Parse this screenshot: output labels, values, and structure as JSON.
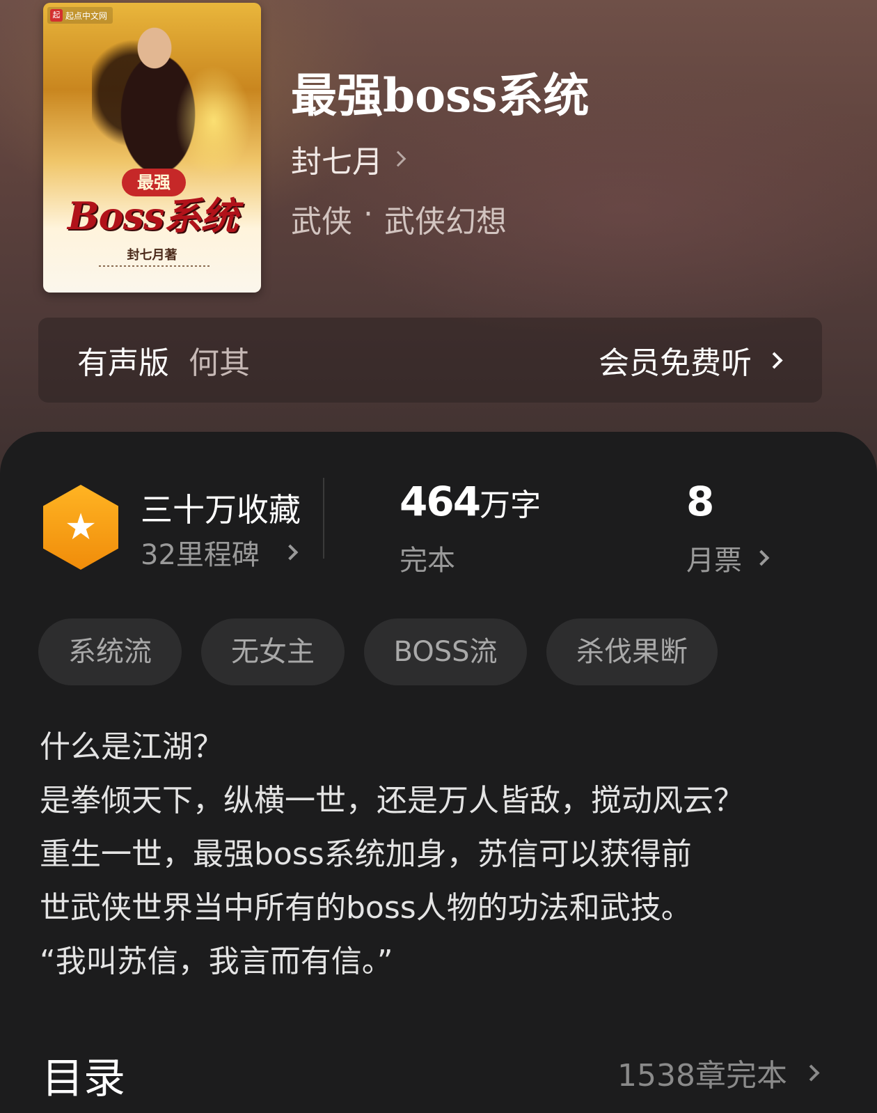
{
  "book": {
    "title": "最强boss系统",
    "author": "封七月",
    "genre": "武侠",
    "genre_separator": "·",
    "subgenre": "武侠幻想",
    "cover": {
      "publisher": "起点中文网",
      "publisher_logo": "起",
      "badge": "最强",
      "title_art": "Boss系统",
      "author_line": "封七月著"
    }
  },
  "audio": {
    "label": "有声版",
    "narrator": "何其",
    "action": "会员免费听"
  },
  "stats": {
    "favorites": "三十万收藏",
    "milestones": "32里程碑",
    "word_count_num": "464",
    "word_count_unit": "万字",
    "status": "完本",
    "monthly_tickets": "8",
    "monthly_tickets_label": "月票"
  },
  "tags": [
    "系统流",
    "无女主",
    "BOSS流",
    "杀伐果断"
  ],
  "description": [
    "什么是江湖？",
    "是拳倾天下，纵横一世，还是万人皆敌，搅动风云？",
    "重生一世，最强boss系统加身，苏信可以获得前",
    "世武侠世界当中所有的boss人物的功法和武技。",
    "“我叫苏信，我言而有信。”"
  ],
  "toc": {
    "title": "目录",
    "summary": "1538章完本"
  },
  "colors": {
    "hero_bg": "#5e423d",
    "panel_bg": "#1c1c1d",
    "badge_orange": "#f5a015",
    "tag_bg": "#2d2d2e"
  },
  "icons": {
    "favorite": "star-icon",
    "chevron": "chevron-right-icon"
  }
}
